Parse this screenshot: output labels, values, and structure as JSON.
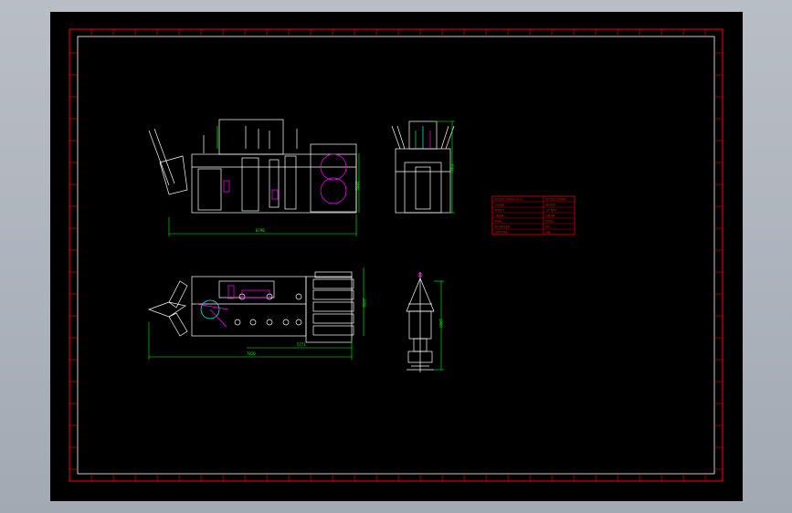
{
  "viewer": {
    "background_color": "#adb3bd",
    "paper_color": "#000000"
  },
  "colors": {
    "frame": "#ff0000",
    "border_inner": "#ffffff",
    "geometry": "#ffffff",
    "dimension": "#00ff00",
    "highlight": "#ff00ff",
    "cyan": "#00ffff",
    "yellow": "#ffff00"
  },
  "dimensions": {
    "front_length": "6790",
    "front_height": "3550",
    "side_height": "3560",
    "top_total": "7820",
    "top_sub": "5771",
    "top_width": "2950",
    "bushing_height": "1960"
  },
  "title_block": {
    "rows": [
      {
        "label": "SFZ10-40000/110",
        "value": "SFZ10-40000"
      },
      {
        "label": "110kV",
        "value": "40000"
      },
      {
        "label": "YNd11",
        "value": "10.5kV"
      },
      {
        "label": "ONAN",
        "value": "ONAN"
      },
      {
        "label": "50Hz",
        "value": "50Hz"
      },
      {
        "label": "IEC60076",
        "value": "IEC"
      },
      {
        "label": "GB1094",
        "value": "GB"
      }
    ]
  }
}
